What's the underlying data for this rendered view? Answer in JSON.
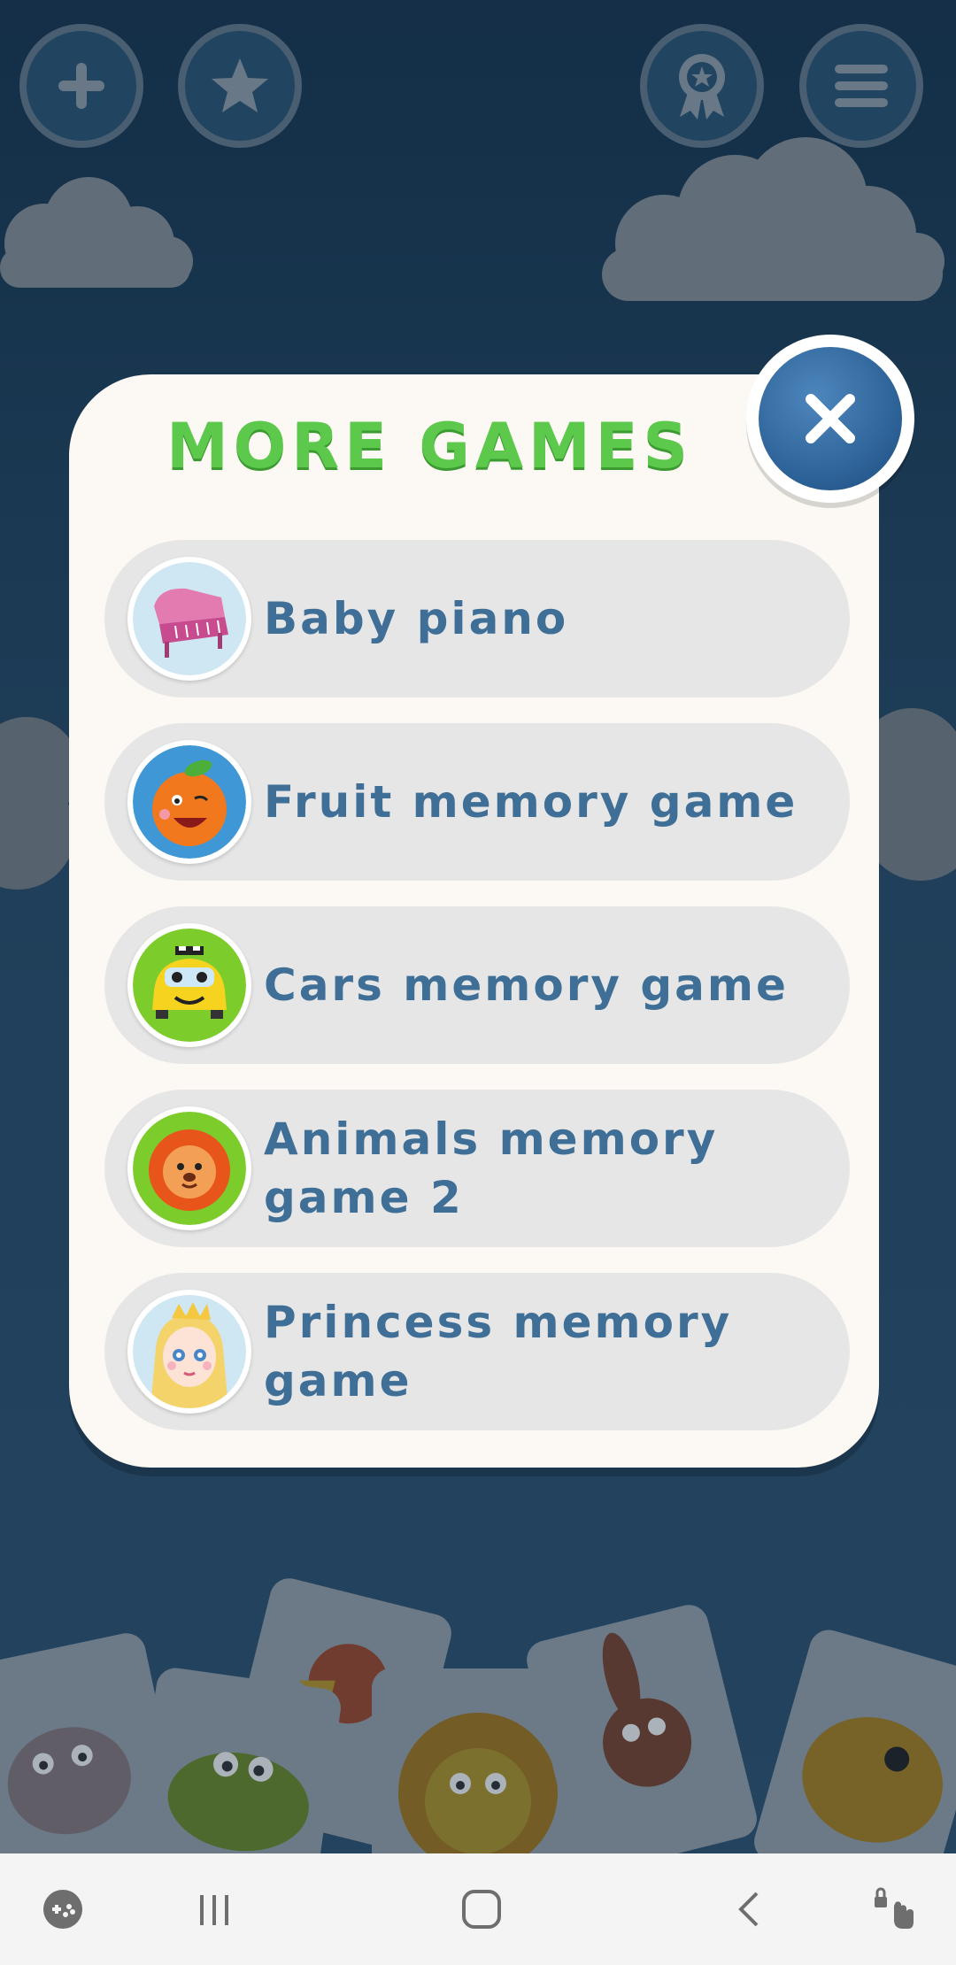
{
  "modal": {
    "title": "MORE GAMES",
    "games": [
      {
        "label": "Baby piano",
        "icon": "piano-icon"
      },
      {
        "label": "Fruit memory game",
        "icon": "orange-icon"
      },
      {
        "label": "Cars memory game",
        "icon": "car-icon"
      },
      {
        "label": "Animals memory game 2",
        "icon": "lion-icon"
      },
      {
        "label": "Princess memory game",
        "icon": "princess-icon"
      }
    ],
    "close_icon": "close-icon"
  },
  "top_bar": {
    "left": [
      "plus-icon",
      "star-icon"
    ],
    "right": [
      "award-icon",
      "menu-icon"
    ]
  },
  "nav_bar": [
    "game-launcher-icon",
    "recent-apps-icon",
    "home-icon",
    "back-icon",
    "accessibility-icon"
  ],
  "colors": {
    "title_green": "#5cc84c",
    "label_blue": "#3f6f96",
    "close_blue": "#2a5f94",
    "background": "#1f4262"
  }
}
